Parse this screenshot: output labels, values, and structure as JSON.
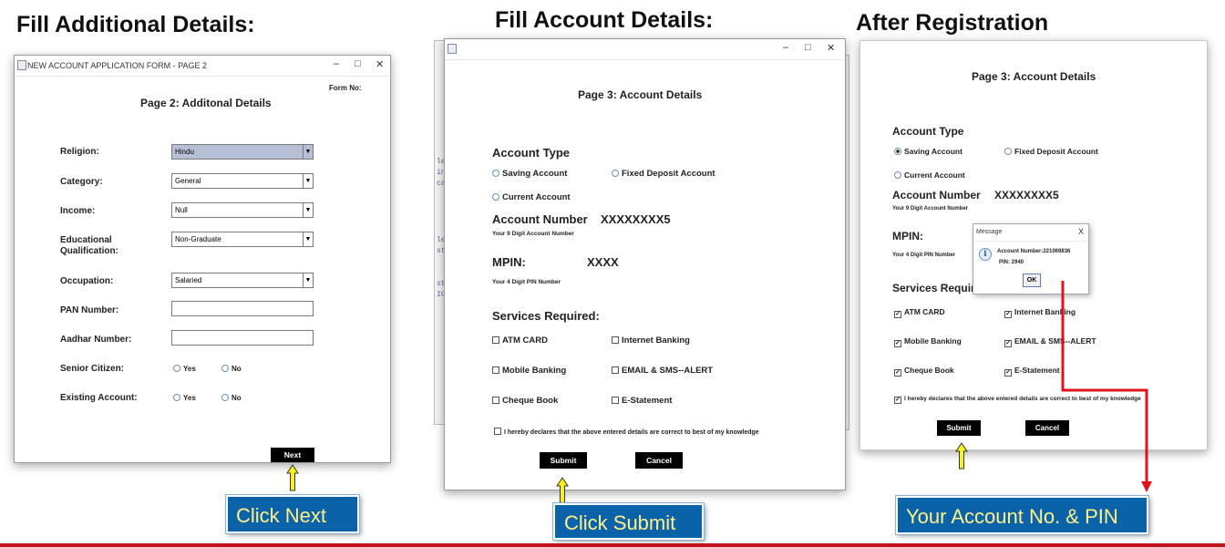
{
  "headings": {
    "left": "Fill Additional Details:",
    "middle": "Fill Account Details:",
    "right": "After Registration"
  },
  "page2": {
    "window_title": "NEW ACCOUNT APPLICATION FORM - PAGE 2",
    "form_no_label": "Form No:",
    "title": "Page 2: Additonal Details",
    "fields": {
      "religion": {
        "label": "Religion:",
        "value": "Hindu"
      },
      "category": {
        "label": "Category:",
        "value": "General"
      },
      "income": {
        "label": "Income:",
        "value": "Null"
      },
      "education": {
        "label_line1": "Educational",
        "label_line2": "Qualification:",
        "value": "Non-Graduate"
      },
      "occupation": {
        "label": "Occupation:",
        "value": "Salaried"
      },
      "pan": {
        "label": "PAN Number:",
        "value": ""
      },
      "aadhar": {
        "label": "Aadhar Number:",
        "value": ""
      },
      "senior": {
        "label": "Senior Citizen:",
        "yes": "Yes",
        "no": "No"
      },
      "existing": {
        "label": "Existing Account:",
        "yes": "Yes",
        "no": "No"
      }
    },
    "next_button": "Next"
  },
  "page3": {
    "window_title": "",
    "title": "Page 3: Account Details",
    "account_type_label": "Account Type",
    "account_types": [
      "Saving Account",
      "Fixed Deposit Account",
      "Current Account"
    ],
    "account_number_label": "Account Number",
    "account_number_value": "XXXXXXXX5",
    "account_number_hint": "Your 9 Digit Account Number",
    "mpin_label": "MPIN:",
    "mpin_value": "XXXX",
    "mpin_hint": "Your 4 Digit PIN Number",
    "services_label": "Services Required:",
    "services": [
      "ATM CARD",
      "Internet Banking",
      "Mobile Banking",
      "EMAIL & SMS--ALERT",
      "Cheque Book",
      "E-Statement"
    ],
    "declaration": "I hereby declares that the above entered details are correct to best of my knowledge",
    "submit_button": "Submit",
    "cancel_button": "Cancel"
  },
  "after": {
    "title": "Page 3: Account Details",
    "account_type_label": "Account Type",
    "account_types": [
      "Saving Account",
      "Fixed Deposit Account",
      "Current Account"
    ],
    "account_number_label": "Account Number",
    "account_number_value": "XXXXXXXX5",
    "account_number_hint": "Your 9 Digit Account Number",
    "mpin_label": "MPIN:",
    "mpin_hint": "Your 4 Digit PIN Number",
    "services_label": "Services Require",
    "services": [
      "ATM CARD",
      "Internet Banking",
      "Mobile Banking",
      "EMAIL & SMS--ALERT",
      "Cheque Book",
      "E-Statement"
    ],
    "declaration": "I hereby declares that the above entered details are correct to best of my knowledge",
    "submit_button": "Submit",
    "cancel_button": "Cancel",
    "dialog": {
      "title": "Message",
      "close": "X",
      "line1": "Account Number:221069836",
      "line2": "PIN: 2940",
      "ok": "OK"
    }
  },
  "callouts": {
    "next": "Click Next",
    "submit": "Click Submit",
    "account": "Your Account No. & PIN"
  },
  "colors": {
    "callout_bg": "#0a62a8",
    "callout_text": "#fff28a",
    "arrow_yellow": "#f7f21c",
    "connector_red": "#e0141e",
    "bottom_line": "#c0131b"
  }
}
